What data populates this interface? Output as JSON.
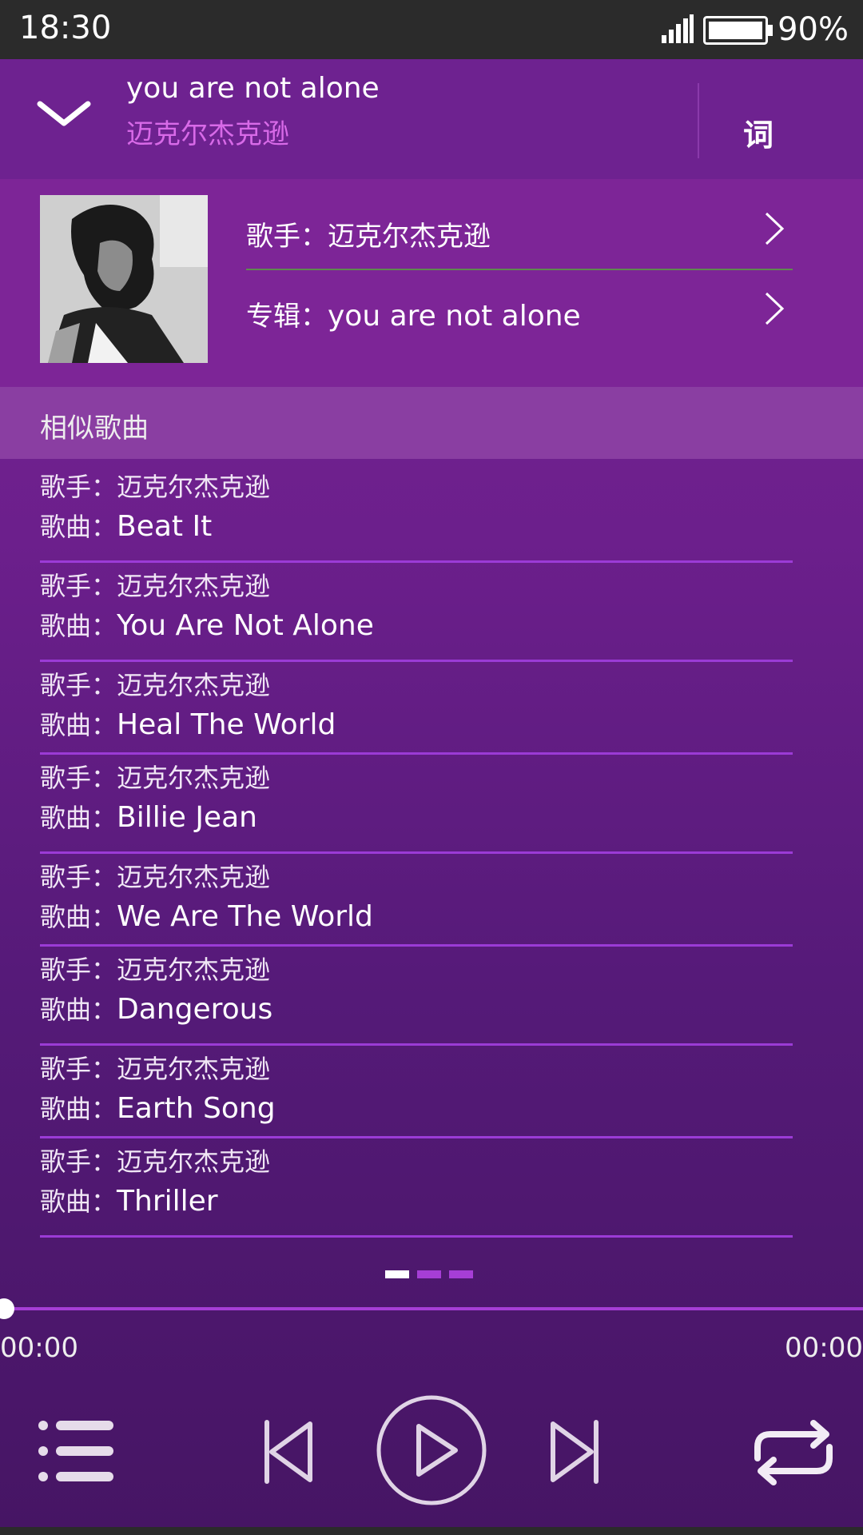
{
  "status_bar": {
    "time": "18:30",
    "battery": "90%"
  },
  "now_playing": {
    "title": "you are not alone",
    "artist": "迈克尔杰克逊",
    "lyrics_button": "词"
  },
  "info": {
    "artist_label": "歌手：",
    "artist_value": "迈克尔杰克逊",
    "album_label": "专辑：",
    "album_value": "you are not alone"
  },
  "similar": {
    "header": "相似歌曲",
    "artist_prefix": "歌手：",
    "song_prefix": "歌曲：",
    "items": [
      {
        "artist": "迈克尔杰克逊",
        "song": "Beat It"
      },
      {
        "artist": "迈克尔杰克逊",
        "song": "You Are Not Alone"
      },
      {
        "artist": "迈克尔杰克逊",
        "song": "Heal The World"
      },
      {
        "artist": "迈克尔杰克逊",
        "song": "Billie Jean"
      },
      {
        "artist": "迈克尔杰克逊",
        "song": "We Are The World"
      },
      {
        "artist": "迈克尔杰克逊",
        "song": "Dangerous"
      },
      {
        "artist": "迈克尔杰克逊",
        "song": "Earth Song"
      },
      {
        "artist": "迈克尔杰克逊",
        "song": "Thriller"
      }
    ]
  },
  "pager": {
    "pages": 3,
    "active": 0
  },
  "player": {
    "current_time": "00:00",
    "total_time": "00:00",
    "progress": 0
  },
  "colors": {
    "accent": "#a63ed6",
    "artist_highlight": "#d86ae8",
    "status_bar": "#2b2b2b"
  }
}
